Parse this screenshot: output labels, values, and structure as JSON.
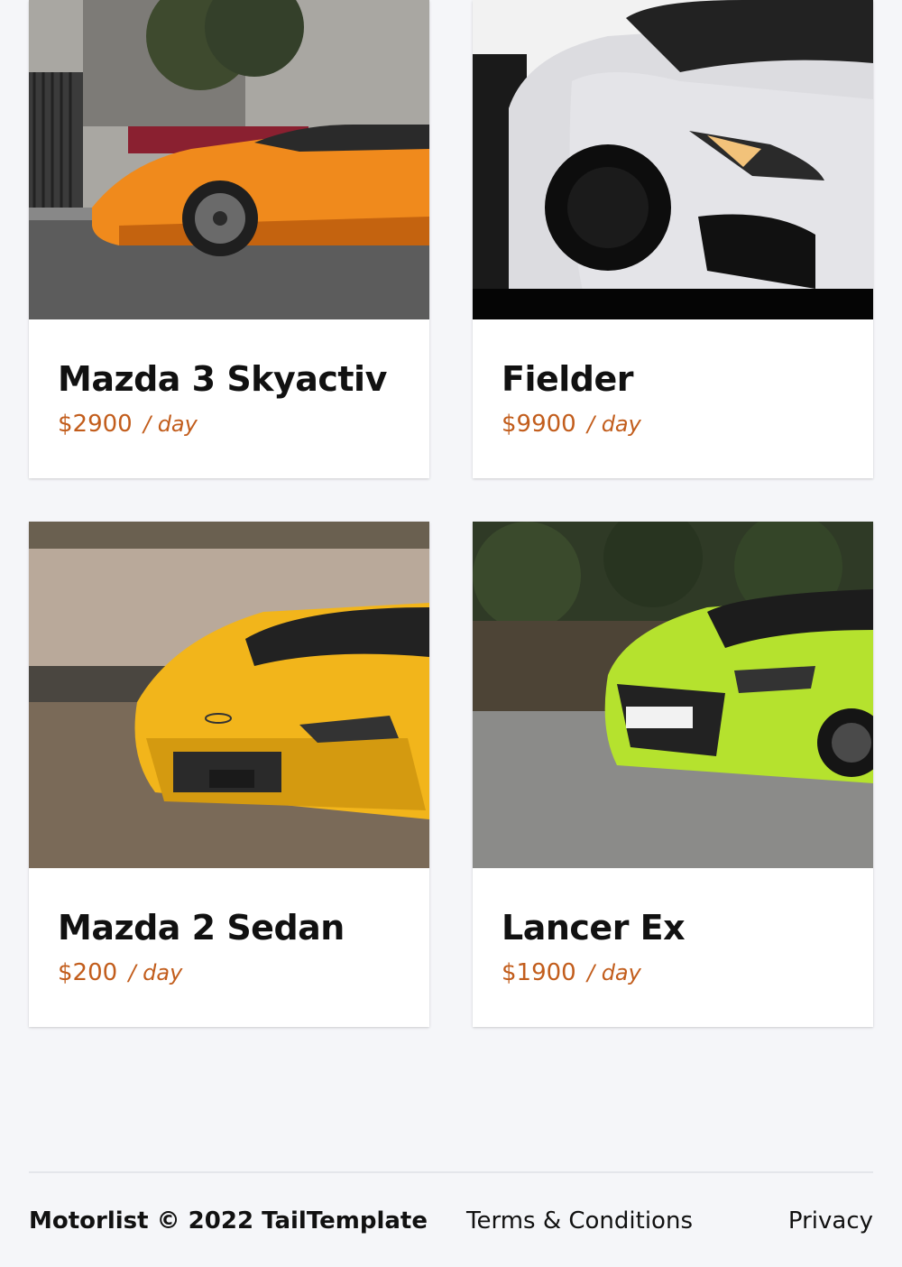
{
  "listings": [
    {
      "name": "Mazda 3 Skyactiv",
      "price": "$2900",
      "per": "/ day",
      "color": "#f08a1c"
    },
    {
      "name": "Fielder",
      "price": "$9900",
      "per": "/ day",
      "color": "#d8d9de"
    },
    {
      "name": "Mazda 2 Sedan",
      "price": "$200",
      "per": "/ day",
      "color": "#f2b51b"
    },
    {
      "name": "Lancer Ex",
      "price": "$1900",
      "per": "/ day",
      "color": "#b5e22e"
    }
  ],
  "footer": {
    "copyright": "Motorlist © 2022 TailTemplate",
    "terms": "Terms & Conditions",
    "privacy": "Privacy"
  },
  "colors": {
    "accent": "#c25d1c",
    "background": "#f5f6f9"
  }
}
